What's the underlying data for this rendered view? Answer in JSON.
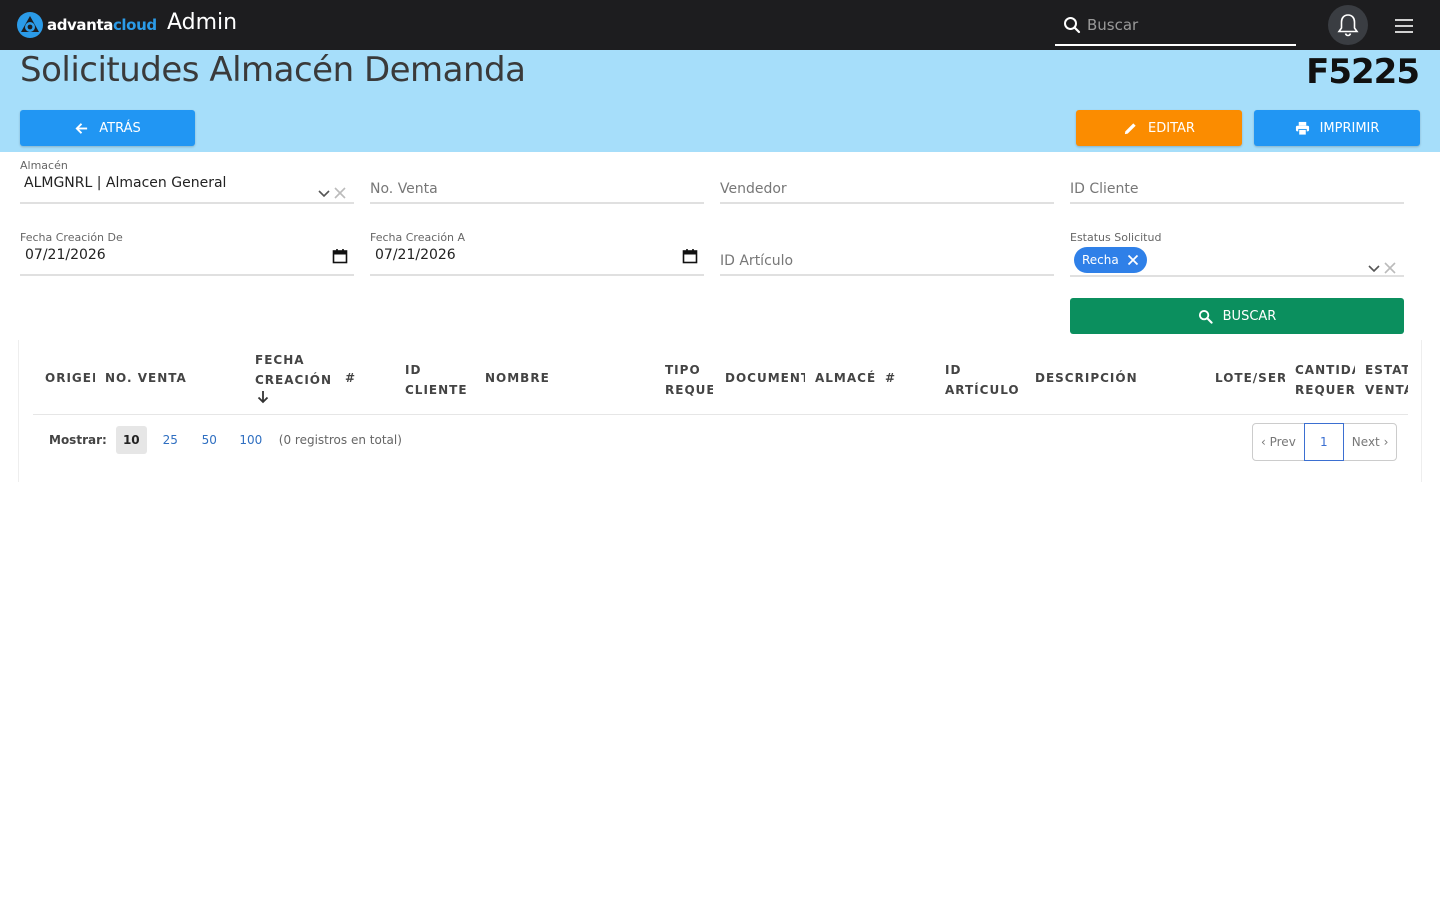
{
  "topbar": {
    "logo_text_white": "advanta",
    "logo_text_blue": "cloud",
    "app_title": "Admin",
    "search_placeholder": "Buscar",
    "brand_blue": "#2b9be8",
    "bar_color": "#1d1d1f"
  },
  "header": {
    "title": "Solicitudes Almacén Demanda",
    "code": "F5225",
    "band_color": "#a6defa",
    "back_label": "ATRÁS",
    "edit_label": "EDITAR",
    "print_label": "IMPRIMIR"
  },
  "filters": {
    "almacen_label": "Almacén",
    "almacen_value": "ALMGNRL | Almacen General",
    "no_venta_placeholder": "No. Venta",
    "vendedor_placeholder": "Vendedor",
    "id_cliente_placeholder": "ID Cliente",
    "fecha_de_label": "Fecha Creación De",
    "fecha_de_value": "07/21/2026",
    "fecha_a_label": "Fecha Creación A",
    "fecha_a_value": "07/21/2026",
    "id_articulo_placeholder": "ID Artículo",
    "estatus_label": "Estatus Solicitud",
    "estatus_chip": "Recha",
    "search_button": "BUSCAR"
  },
  "table": {
    "columns": [
      {
        "l1": "ORIGEN",
        "l2": ""
      },
      {
        "l1": "NO. VENTA",
        "l2": ""
      },
      {
        "l1": "FECHA",
        "l2": "CREACIÓN"
      },
      {
        "l1": "#",
        "l2": ""
      },
      {
        "l1": "ID",
        "l2": "CLIENTE"
      },
      {
        "l1": "NOMBRE",
        "l2": ""
      },
      {
        "l1": "TIPO",
        "l2": "REQUE"
      },
      {
        "l1": "DOCUMENT",
        "l2": ""
      },
      {
        "l1": "ALMACÉN",
        "l2": ""
      },
      {
        "l1": "#",
        "l2": ""
      },
      {
        "l1": "ID",
        "l2": "ARTÍCULO"
      },
      {
        "l1": "DESCRIPCIÓN",
        "l2": ""
      },
      {
        "l1": "LOTE/SERIE",
        "l2": ""
      },
      {
        "l1": "CANTIDAD",
        "l2": "REQUERIDA"
      },
      {
        "l1": "ESTATUS",
        "l2": "VENTA"
      }
    ],
    "sorted_column": "FECHA CREACIÓN",
    "sort_direction": "descending"
  },
  "pager": {
    "show_label": "Mostrar:",
    "sizes": [
      "10",
      "25",
      "50",
      "100"
    ],
    "active_size": "10",
    "total_text": "(0 registros en total)",
    "prev_label": "‹ Prev",
    "current_page": "1",
    "next_label": "Next ›"
  },
  "colors": {
    "primary": "#2196f3",
    "warning": "#fb8c00",
    "success": "#0b8f5e",
    "chip": "#2f80e8"
  }
}
